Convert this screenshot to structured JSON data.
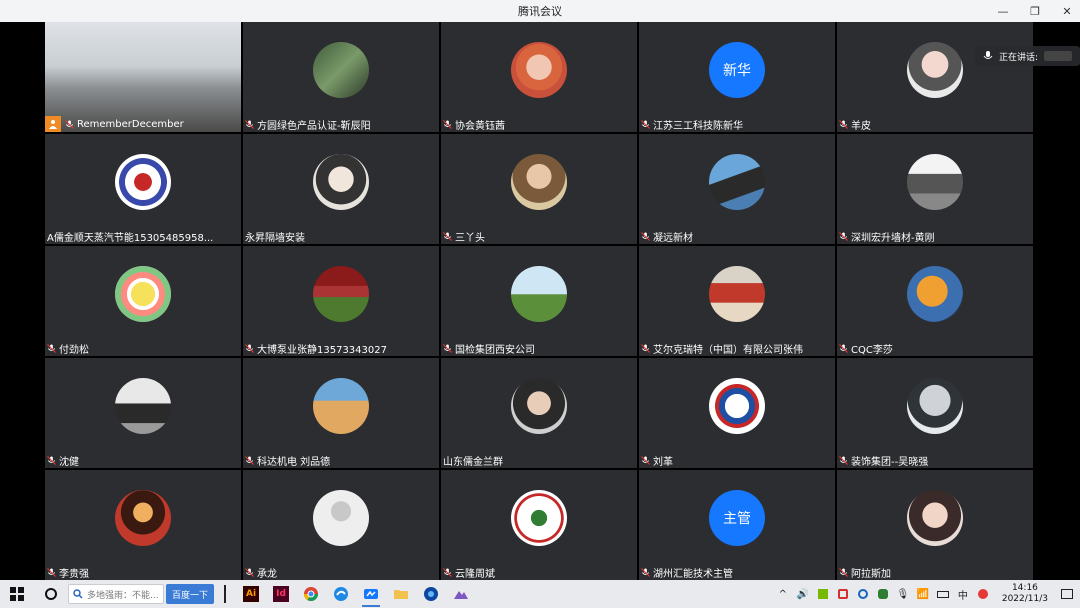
{
  "window": {
    "title": "腾讯会议",
    "controls": [
      "—",
      "❐",
      "✕"
    ]
  },
  "speaking": {
    "label": "正在讲话:"
  },
  "participants": [
    {
      "name": "RememberDecember",
      "avatar_style": "room-photo"
    },
    {
      "name": "方圆绿色产品认证-靳辰阳",
      "avatar_style": "linear-gradient(135deg,#3f5b3a,#7a9a6a,#2c3b28)"
    },
    {
      "name": "协会黄钰茜",
      "avatar_style": "radial-gradient(circle at 50% 45%,#f1c7b3 0 30%,#d9653f 31% 55%,#c9503b 56%)"
    },
    {
      "name": "江苏三工科技陈新华",
      "avatar_text": "新华",
      "avatar_style": "#1677ff"
    },
    {
      "name": "羊皮",
      "avatar_style": "radial-gradient(circle at 50% 40%,#f3d8cf 0 30%,#555 31% 60%,#e9e9e9 61%)"
    },
    {
      "name": "A儒金顺天蒸汽节能15305485958...",
      "avatar_style": "radial-gradient(circle,#c62828 0 22%,#fff 23% 45%,#3949ab 46% 60%,#fff 61%)",
      "no_mic": true
    },
    {
      "name": "永昇隔墙安装",
      "avatar_style": "radial-gradient(circle at 50% 45%,#f0e6dc 0 30%,#333 31% 60%,#e6e2dc 61%)",
      "no_mic": true
    },
    {
      "name": "三丫头",
      "avatar_style": "radial-gradient(circle at 50% 40%,#e8c7a8 0 28%,#7a5a3a 29% 60%,#d9c8a0 61%)"
    },
    {
      "name": "凝远新材",
      "avatar_style": "linear-gradient(160deg,#6aa6d9 0 40%,#2a2a2a 41% 70%,#4b7fb3 71%)"
    },
    {
      "name": "深圳宏升墙材-黄刚",
      "avatar_style": "linear-gradient(180deg,#f3f3f3 0 35%,#555 36% 70%,#888 71%)"
    },
    {
      "name": "付劲松",
      "avatar_style": "radial-gradient(circle,#f6e25a 0 30%,#ffffff 31% 40%,#ff8a80 41% 55%,#81c784 56% 70%,#f5f5f5 71%)"
    },
    {
      "name": "大博泵业张静13573343027",
      "avatar_style": "linear-gradient(180deg,#8b1a1a 0 35%,#a33 36% 55%,#4d7a2e 56%)"
    },
    {
      "name": "国检集团西安公司",
      "avatar_style": "linear-gradient(180deg,#cfe6f5 0 50%,#5b8f3a 51%)"
    },
    {
      "name": "艾尔克瑞特（中国）有限公司张伟",
      "avatar_style": "linear-gradient(180deg,#d9d2c6 0 30%,#c0392b 31% 65%,#e6d8c2 66%)"
    },
    {
      "name": "CQC李莎",
      "avatar_style": "radial-gradient(circle at 45% 45%,#f0a030 0 35%,#3b6fb0 36% 70%,#2a3d5a 71%)"
    },
    {
      "name": "沈健",
      "avatar_style": "linear-gradient(180deg,#e8e8e8 0 45%,#2a2a2a 46% 80%,#9a9a9a 81%)"
    },
    {
      "name": "科达机电 刘品德",
      "avatar_style": "linear-gradient(180deg,#6ea8d8 0 40%,#e0a860 41%)"
    },
    {
      "name": "山东儒金兰群",
      "avatar_style": "radial-gradient(circle at 50% 45%,#e8cdb9 0 28%,#2a2a2a 29% 62%,#cfcfcf 63%)",
      "no_mic": true
    },
    {
      "name": "刘革",
      "avatar_style": "radial-gradient(circle,#fff 0 30%,#1e4fa3 31% 45%,#c62828 46% 55%,#fff 56%)"
    },
    {
      "name": "装饰集团--吴晓强",
      "avatar_style": "radial-gradient(circle at 50% 40%,#cfd3d8 0 35%,#2f3438 36% 62%,#e6e9ec 63%)"
    },
    {
      "name": "李贵强",
      "avatar_style": "radial-gradient(circle at 50% 40%,#f0b060 0 22%,#3a1a10 23% 50%,#c0392b 51%)"
    },
    {
      "name": "承龙",
      "avatar_style": "radial-gradient(circle at 50% 38%,#c8c8c8 0 22%,#eeeeee 23%)"
    },
    {
      "name": "云隆周斌",
      "avatar_style": "radial-gradient(circle,#2e7d32 0 20%,#ffffff 21% 55%,#c62828 56% 62%,#ffffff 63%)"
    },
    {
      "name": "湖州汇能技术主管",
      "avatar_text": "主管",
      "avatar_style": "#1677ff"
    },
    {
      "name": "阿拉斯加",
      "avatar_style": "radial-gradient(circle at 50% 45%,#f1d6c8 0 30%,#3a2a2a 31% 62%,#e7dcd6 63%)"
    }
  ],
  "taskbar": {
    "search_placeholder": "多地强雨：不能...",
    "search_button": "百度一下",
    "apps": [
      "Ai",
      "Id",
      "chrome",
      "edge",
      "meeting",
      "files",
      "antivirus",
      "browser"
    ],
    "time": "14:16",
    "date": "2022/11/3",
    "tray_lang": "中"
  }
}
